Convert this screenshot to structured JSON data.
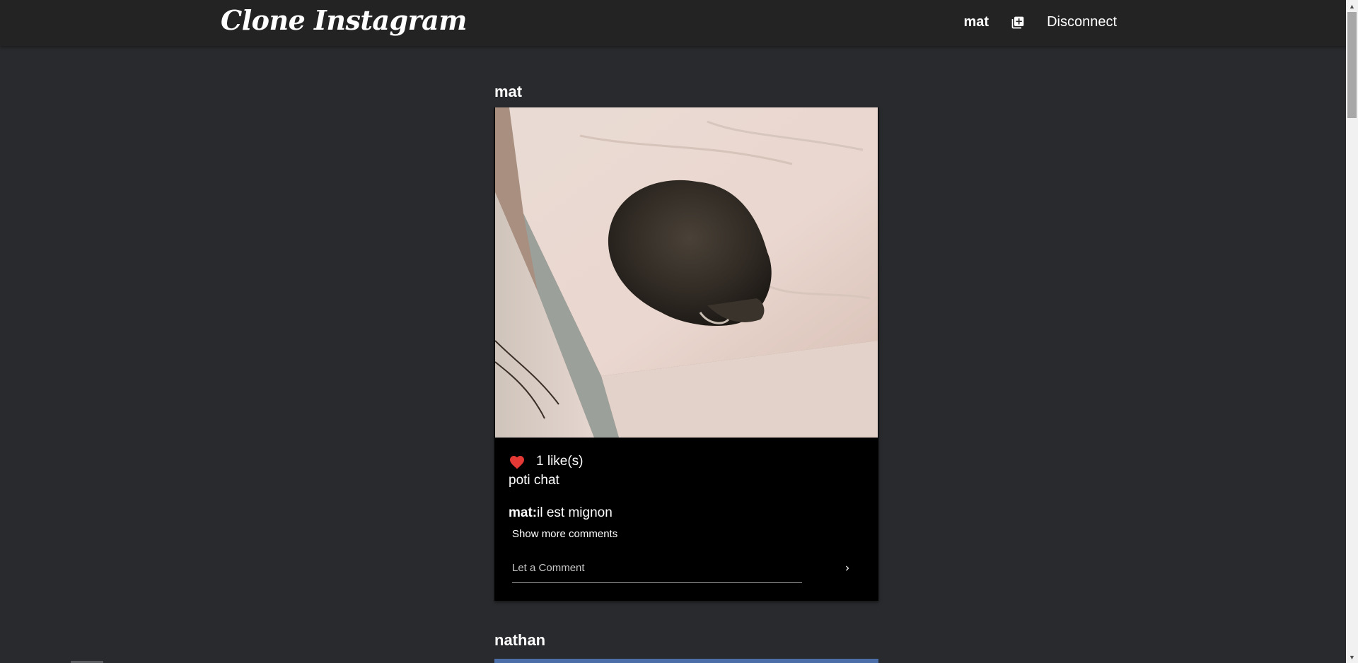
{
  "brand": "Clone Instagram",
  "nav": {
    "username": "mat",
    "add_icon": "add-box-icon",
    "disconnect": "Disconnect"
  },
  "posts": [
    {
      "author": "mat",
      "image_alt": "cat-on-bed-photo",
      "likes": "1 like(s)",
      "liked": true,
      "caption": "poti chat",
      "comments": [
        {
          "user": "mat:",
          "text": "il est mignon"
        }
      ],
      "show_more": "Show more comments",
      "comment_placeholder": "Let a Comment"
    },
    {
      "author": "nathan"
    }
  ],
  "colors": {
    "background": "#282a2d",
    "navbar": "#232323",
    "card": "#000000",
    "heart": "#e53935"
  }
}
